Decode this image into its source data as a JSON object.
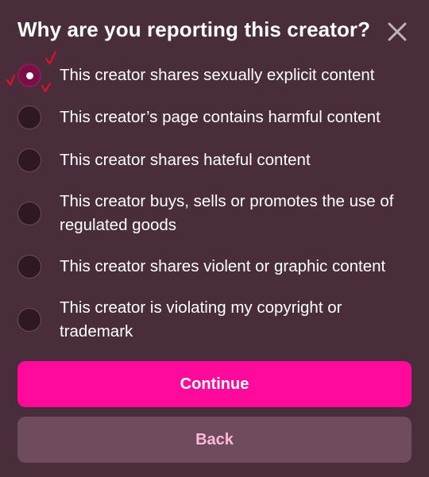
{
  "dialog": {
    "title": "Why are you reporting this creator?",
    "close_icon": "close-icon"
  },
  "options": [
    {
      "label": "This creator shares sexually explicit content",
      "selected": true
    },
    {
      "label": "This creator’s page contains harmful content",
      "selected": false
    },
    {
      "label": "This creator shares hateful content",
      "selected": false
    },
    {
      "label": "This creator buys, sells or promotes the use of regulated goods",
      "selected": false
    },
    {
      "label": "This creator shares violent or graphic content",
      "selected": false
    },
    {
      "label": "This creator is violating my copyright or trademark",
      "selected": false
    }
  ],
  "buttons": {
    "continue_label": "Continue",
    "back_label": "Back"
  },
  "colors": {
    "background": "#4a2d3b",
    "accent": "#ff0a9a",
    "selected_radio": "#7a0f45",
    "back_button": "#6e4c5d",
    "back_text": "#ffb8dc",
    "annotation_mark": "#e0102a"
  }
}
